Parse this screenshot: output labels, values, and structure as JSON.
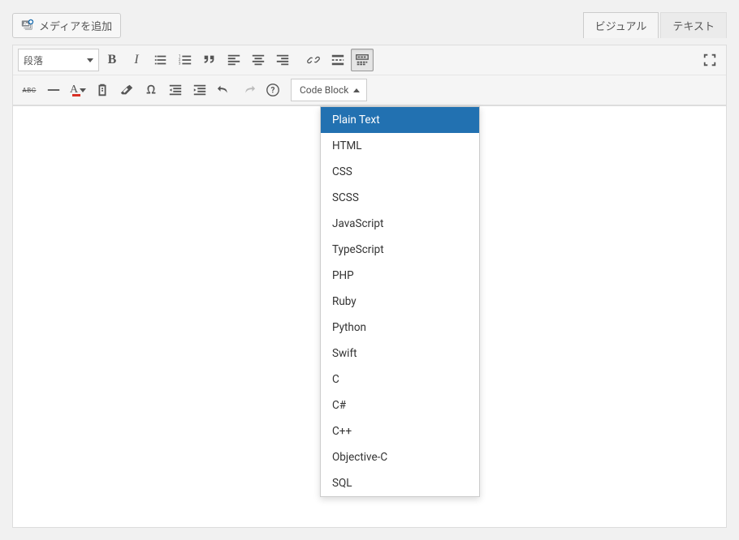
{
  "media_button_label": "メディアを追加",
  "tabs": {
    "visual": "ビジュアル",
    "text": "テキスト"
  },
  "format_select": "段落",
  "code_block_label": "Code Block",
  "dropdown": {
    "selected": "Plain Text",
    "items": [
      "Plain Text",
      "HTML",
      "CSS",
      "SCSS",
      "JavaScript",
      "TypeScript",
      "PHP",
      "Ruby",
      "Python",
      "Swift",
      "C",
      "C#",
      "C++",
      "Objective-C",
      "SQL"
    ]
  },
  "icons": {
    "bold": "B",
    "italic": "I",
    "strike": "ABC",
    "textcolor": "A"
  },
  "colors": {
    "text_color_swatch": "#d93025",
    "selection_bg": "#2271b1"
  }
}
